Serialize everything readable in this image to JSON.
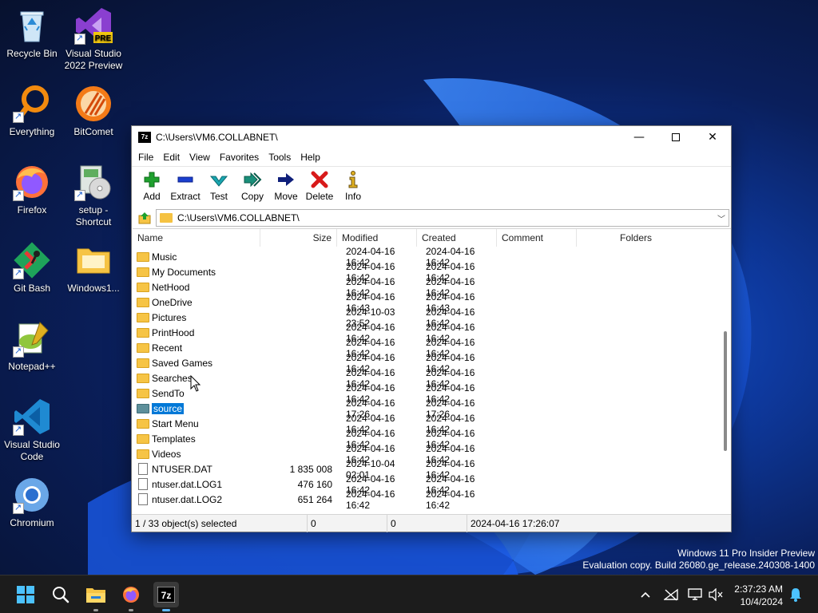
{
  "desktop": {
    "icons": [
      {
        "label": "Recycle Bin"
      },
      {
        "label": "Visual Studio 2022 Preview"
      },
      {
        "label": "Everything"
      },
      {
        "label": "BitComet"
      },
      {
        "label": "Firefox"
      },
      {
        "label": "setup - Shortcut"
      },
      {
        "label": "Git Bash"
      },
      {
        "label": "Windows1..."
      },
      {
        "label": "Notepad++"
      },
      {
        "label": "Visual Studio Code"
      },
      {
        "label": "Chromium"
      }
    ]
  },
  "window": {
    "app_icon": "7z",
    "title": "C:\\Users\\VM6.COLLABNET\\",
    "menu": [
      "File",
      "Edit",
      "View",
      "Favorites",
      "Tools",
      "Help"
    ],
    "toolbar": [
      {
        "label": "Add",
        "icon": "plus-icon",
        "color": "#1fa02e"
      },
      {
        "label": "Extract",
        "icon": "minus-icon",
        "color": "#1a3fcf"
      },
      {
        "label": "Test",
        "icon": "check-icon",
        "color": "#1aa6b0"
      },
      {
        "label": "Copy",
        "icon": "double-arrow-icon",
        "color": "#1a8f7a"
      },
      {
        "label": "Move",
        "icon": "arrow-right-icon",
        "color": "#0f1f7a"
      },
      {
        "label": "Delete",
        "icon": "x-icon",
        "color": "#d81a1a"
      },
      {
        "label": "Info",
        "icon": "info-icon",
        "color": "#e0b020"
      }
    ],
    "address": "C:\\Users\\VM6.COLLABNET\\",
    "columns": [
      "Name",
      "Size",
      "Modified",
      "Created",
      "Comment",
      "Folders"
    ],
    "rows": [
      {
        "name": "Music",
        "type": "folder",
        "size": "",
        "modified": "2024-04-16 16:42",
        "created": "2024-04-16 16:42"
      },
      {
        "name": "My Documents",
        "type": "folder",
        "size": "",
        "modified": "2024-04-16 16:42",
        "created": "2024-04-16 16:42"
      },
      {
        "name": "NetHood",
        "type": "folder",
        "size": "",
        "modified": "2024-04-16 16:42",
        "created": "2024-04-16 16:42"
      },
      {
        "name": "OneDrive",
        "type": "folder",
        "size": "",
        "modified": "2024-04-16 16:43",
        "created": "2024-04-16 16:43"
      },
      {
        "name": "Pictures",
        "type": "folder",
        "size": "",
        "modified": "2024-10-03 23:52",
        "created": "2024-04-16 16:42"
      },
      {
        "name": "PrintHood",
        "type": "folder",
        "size": "",
        "modified": "2024-04-16 16:42",
        "created": "2024-04-16 16:42"
      },
      {
        "name": "Recent",
        "type": "folder",
        "size": "",
        "modified": "2024-04-16 16:42",
        "created": "2024-04-16 16:42"
      },
      {
        "name": "Saved Games",
        "type": "folder",
        "size": "",
        "modified": "2024-04-16 16:42",
        "created": "2024-04-16 16:42"
      },
      {
        "name": "Searches",
        "type": "folder",
        "size": "",
        "modified": "2024-04-16 16:42",
        "created": "2024-04-16 16:42"
      },
      {
        "name": "SendTo",
        "type": "folder",
        "size": "",
        "modified": "2024-04-16 16:42",
        "created": "2024-04-16 16:42"
      },
      {
        "name": "source",
        "type": "folder-selected",
        "size": "",
        "modified": "2024-04-16 17:26",
        "created": "2024-04-16 17:26"
      },
      {
        "name": "Start Menu",
        "type": "folder",
        "size": "",
        "modified": "2024-04-16 16:42",
        "created": "2024-04-16 16:42"
      },
      {
        "name": "Templates",
        "type": "folder",
        "size": "",
        "modified": "2024-04-16 16:42",
        "created": "2024-04-16 16:42"
      },
      {
        "name": "Videos",
        "type": "folder",
        "size": "",
        "modified": "2024-04-16 16:42",
        "created": "2024-04-16 16:42"
      },
      {
        "name": "NTUSER.DAT",
        "type": "file",
        "size": "1 835 008",
        "modified": "2024-10-04 02:01",
        "created": "2024-04-16 16:42"
      },
      {
        "name": "ntuser.dat.LOG1",
        "type": "file",
        "size": "476 160",
        "modified": "2024-04-16 16:42",
        "created": "2024-04-16 16:42"
      },
      {
        "name": "ntuser.dat.LOG2",
        "type": "file",
        "size": "651 264",
        "modified": "2024-04-16 16:42",
        "created": "2024-04-16 16:42"
      }
    ],
    "status": {
      "selected": "1 / 33 object(s) selected",
      "size": "0",
      "packed": "0",
      "date": "2024-04-16 17:26:07"
    }
  },
  "watermark": {
    "line1": "Windows 11 Pro Insider Preview",
    "line2": "Evaluation copy. Build 26080.ge_release.240308-1400"
  },
  "taskbar": {
    "time": "2:37:23 AM",
    "date": "10/4/2024"
  },
  "colors": {
    "selection": "#0078d7",
    "folder": "#f6c445"
  }
}
